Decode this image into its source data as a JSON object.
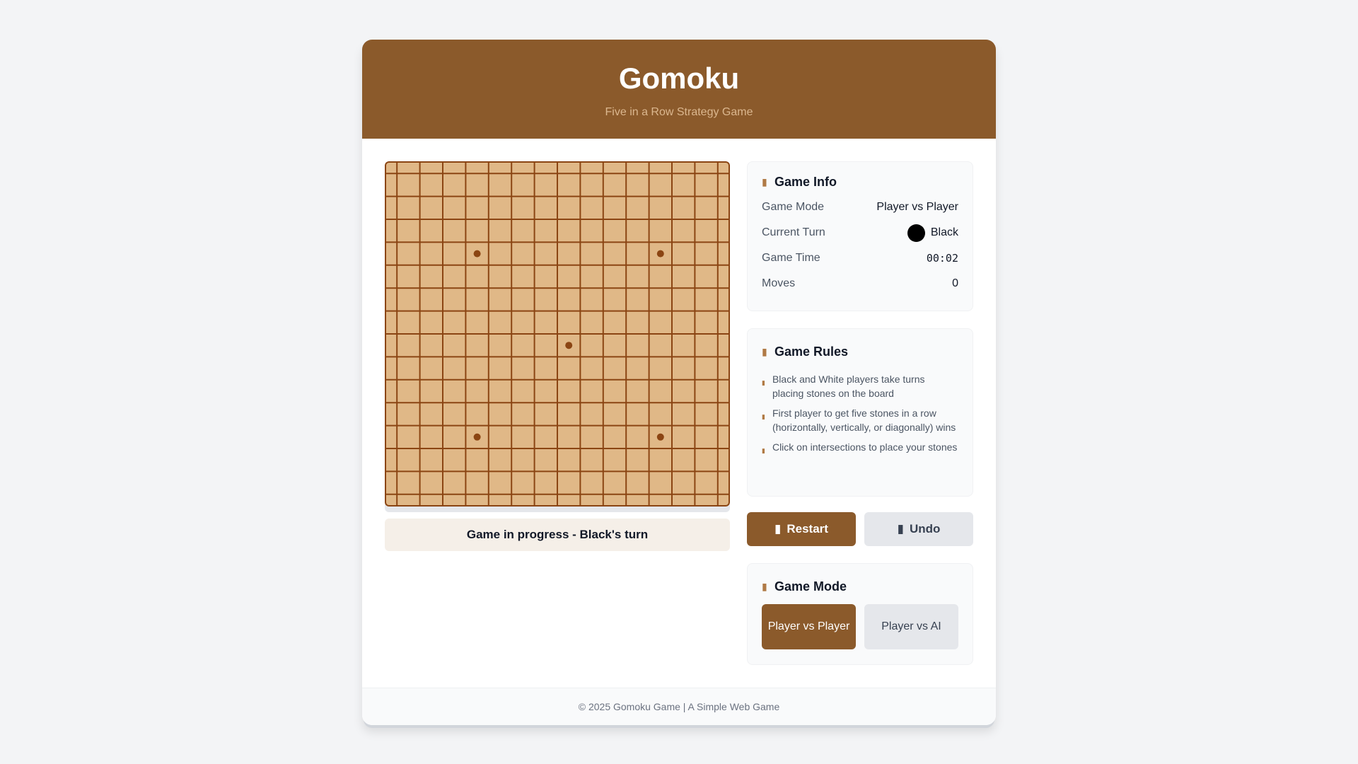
{
  "header": {
    "title": "Gomoku",
    "subtitle": "Five in a Row Strategy Game"
  },
  "board": {
    "size": 15,
    "star_points": [
      [
        3,
        3
      ],
      [
        3,
        11
      ],
      [
        7,
        7
      ],
      [
        11,
        3
      ],
      [
        11,
        11
      ]
    ],
    "stones": [],
    "colors": {
      "wood": "#e0b887",
      "line": "#8b4513",
      "star": "#8b4513"
    }
  },
  "status": "Game in progress - Black's turn",
  "game_info": {
    "title": "Game Info",
    "icon": "info-circle-icon",
    "rows": {
      "mode": {
        "label": "Game Mode",
        "value": "Player vs Player"
      },
      "turn": {
        "label": "Current Turn",
        "value": "Black"
      },
      "time": {
        "label": "Game Time",
        "value": "00:02"
      },
      "moves": {
        "label": "Moves",
        "value": "0"
      }
    }
  },
  "rules": {
    "title": "Game Rules",
    "icon": "book-icon",
    "items": [
      "Black and White players take turns placing stones on the board",
      "First player to get five stones in a row (horizontally, vertically, or diagonally) wins",
      "Click on intersections to place your stones"
    ]
  },
  "actions": {
    "restart": "Restart",
    "undo": "Undo"
  },
  "mode": {
    "title": "Game Mode",
    "icon": "gamepad-icon",
    "pvp": "Player vs Player",
    "pvai": "Player vs AI",
    "selected": "Player vs Player"
  },
  "footer": "© 2025 Gomoku Game | A Simple Web Game",
  "theme": {
    "brand": "#8b5a2b",
    "background": "#f3f4f6"
  }
}
